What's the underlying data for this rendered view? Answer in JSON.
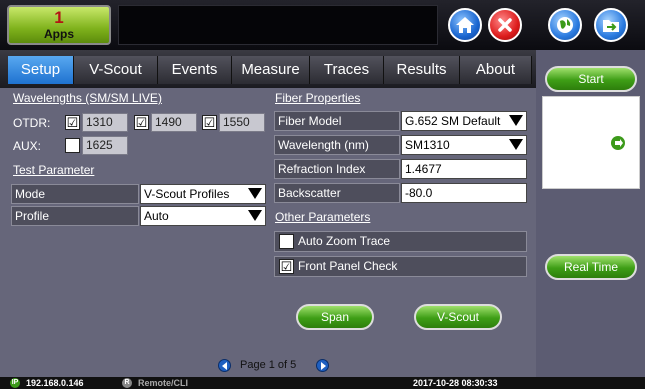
{
  "topbar": {
    "apps_count": "1",
    "apps_label": "Apps"
  },
  "tabs": [
    {
      "label": "Setup",
      "active": true
    },
    {
      "label": "V-Scout"
    },
    {
      "label": "Events"
    },
    {
      "label": "Measure"
    },
    {
      "label": "Traces"
    },
    {
      "label": "Results"
    },
    {
      "label": "About"
    }
  ],
  "wavelengths": {
    "heading": "Wavelengths (SM/SM LIVE)",
    "otdr_label": "OTDR:",
    "aux_label": "AUX:",
    "w1": "1310",
    "w2": "1490",
    "w3": "1550",
    "aux": "1625"
  },
  "test_parameter": {
    "heading": "Test Parameter",
    "mode_label": "Mode",
    "mode_value": "V-Scout Profiles",
    "profile_label": "Profile",
    "profile_value": "Auto"
  },
  "fiber": {
    "heading": "Fiber Properties",
    "model_label": "Fiber Model",
    "model_value": "G.652 SM Default",
    "wavelength_label": "Wavelength (nm)",
    "wavelength_value": "SM1310",
    "refraction_label": "Refraction Index",
    "refraction_value": "1.4677",
    "backscatter_label": "Backscatter",
    "backscatter_value": "-80.0"
  },
  "other": {
    "heading": "Other Parameters",
    "auto_zoom": "Auto Zoom Trace",
    "front_panel": "Front Panel Check"
  },
  "buttons": {
    "span": "Span",
    "vscout": "V-Scout",
    "start": "Start",
    "realtime": "Real Time"
  },
  "pager": {
    "text": "Page 1 of 5"
  },
  "status": {
    "ip": "192.168.0.146",
    "remote": "Remote/CLI",
    "datetime": "2017-10-28 08:30:33"
  },
  "colors": {
    "accent": "#1f72d0",
    "green": "#3e9e16",
    "panel": "#66667a"
  }
}
